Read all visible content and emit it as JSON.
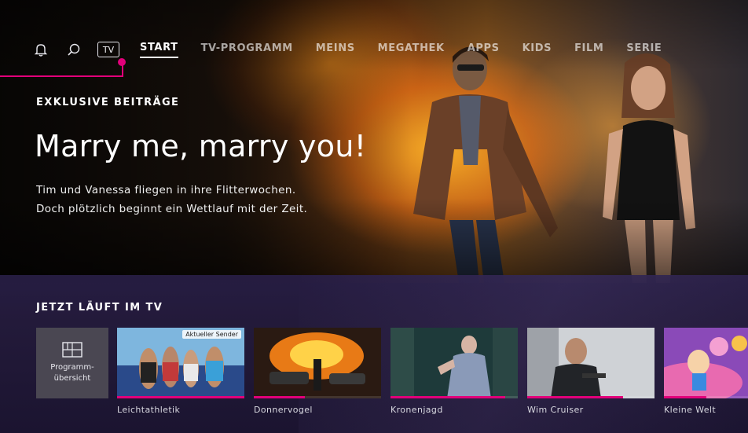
{
  "nav": {
    "tv_label": "TV",
    "items": [
      {
        "label": "START",
        "active": true
      },
      {
        "label": "TV-PROGRAMM",
        "active": false
      },
      {
        "label": "MEINS",
        "active": false
      },
      {
        "label": "MEGATHEK",
        "active": false
      },
      {
        "label": "APPS",
        "active": false
      },
      {
        "label": "KIDS",
        "active": false
      },
      {
        "label": "FILM",
        "active": false
      },
      {
        "label": "SERIE",
        "active": false
      }
    ],
    "icons": [
      "bell-icon",
      "search-icon",
      "tv-icon"
    ]
  },
  "hero": {
    "kicker": "EXKLUSIVE BEITRÄGE",
    "title": "Marry me, marry you!",
    "description_line1": "Tim und Vanessa fliegen in ihre Flitterwochen.",
    "description_line2": "Doch plötzlich beginnt ein Wettlauf mit der Zeit."
  },
  "live": {
    "heading": "JETZT LÄUFT IM TV",
    "overview_label_line1": "Programm-",
    "overview_label_line2": "übersicht",
    "tiles": [
      {
        "title": "Leichtathletik",
        "badge": "Aktueller Sender",
        "progress": 1.0
      },
      {
        "title": "Donnervogel",
        "badge": "",
        "progress": 0.4
      },
      {
        "title": "Kronenjagd",
        "badge": "",
        "progress": 0.9
      },
      {
        "title": "Wim Cruiser",
        "badge": "",
        "progress": 0.75
      },
      {
        "title": "Kleine Welt",
        "badge": "",
        "progress": 0.5
      }
    ]
  },
  "colors": {
    "accent": "#e2007a",
    "band": "#231a3a",
    "tile_overview": "#4a4752"
  }
}
